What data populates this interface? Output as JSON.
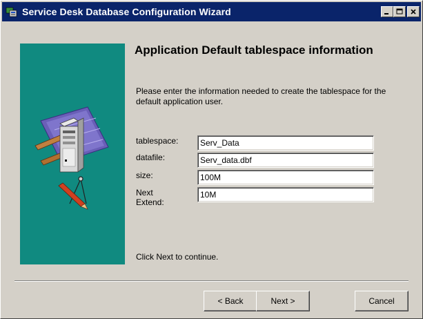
{
  "window": {
    "title": "Service Desk Database Configuration Wizard",
    "minimize_glyph": "▁",
    "maximize_glyph": "□",
    "close_glyph": "✕"
  },
  "content": {
    "heading": "Application Default tablespace information",
    "description": "Please enter the information needed to create the tablespace for the default application user.",
    "footer": "Click Next to continue."
  },
  "form": {
    "tablespace": {
      "label": "tablespace:",
      "value": "Serv_Data"
    },
    "datafile": {
      "label": "datafile:",
      "value": "Serv_data.dbf"
    },
    "size": {
      "label": "size:",
      "value": "100M"
    },
    "next_extend": {
      "label": "Next\nExtend:",
      "value": "10M"
    }
  },
  "buttons": {
    "back": "< Back",
    "next": "Next >",
    "cancel": "Cancel"
  },
  "colors": {
    "titlebar": "#0a246a",
    "side_panel": "#108a80",
    "dialog_face": "#d4d0c8"
  }
}
